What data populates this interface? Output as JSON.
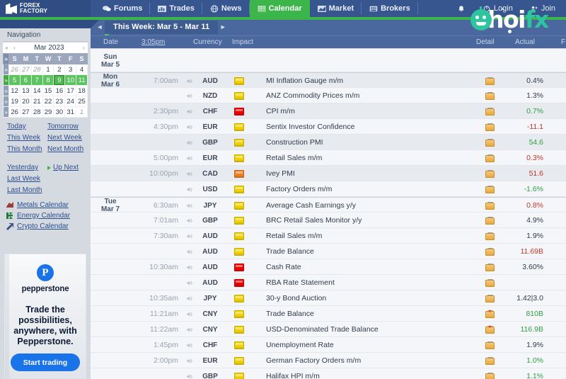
{
  "brand": {
    "line1": "FOREX",
    "line2": "FACTORY",
    "logo_icon": "forex-factory-logo-icon"
  },
  "topnav": {
    "items": [
      {
        "label": "Forums",
        "icon": "speech-bubbles-icon",
        "active": false
      },
      {
        "label": "Trades",
        "icon": "bar-chart-icon",
        "active": false
      },
      {
        "label": "News",
        "icon": "globe-icon",
        "active": false
      },
      {
        "label": "Calendar",
        "icon": "calendar-grid-icon",
        "active": true
      },
      {
        "label": "Market",
        "icon": "mountain-chart-icon",
        "active": false
      },
      {
        "label": "Brokers",
        "icon": "building-icon",
        "active": false
      }
    ],
    "right": [
      {
        "label": "",
        "icon": "bell-icon"
      },
      {
        "label": "Login",
        "icon": "login-icon"
      },
      {
        "label": "Join",
        "icon": "user-plus-icon"
      }
    ],
    "accent_color": "#3cb54a",
    "bar_color": "#37568f"
  },
  "watermark": {
    "text_dark": "ch",
    "text_mid": "o",
    "text_light": "i",
    "text_accent": "fx",
    "full": "choifx",
    "color": "#2ec4a0"
  },
  "sidebar": {
    "title": "Navigation",
    "datepicker": {
      "month_label": "Mar 2023",
      "prev_year_icon": "double-chevron-left-icon",
      "prev_month_icon": "chevron-left-icon",
      "next_month_icon": "chevron-right-icon",
      "weekday_headers": [
        "S",
        "M",
        "T",
        "W",
        "T",
        "F",
        "S"
      ],
      "week_col_icon": "week-select-icon",
      "weeks": [
        {
          "selected": false,
          "days": [
            {
              "n": "26",
              "out": true
            },
            {
              "n": "27",
              "out": true
            },
            {
              "n": "28",
              "out": true
            },
            {
              "n": "1"
            },
            {
              "n": "2"
            },
            {
              "n": "3"
            },
            {
              "n": "4"
            }
          ]
        },
        {
          "selected": true,
          "days": [
            {
              "n": "5"
            },
            {
              "n": "6"
            },
            {
              "n": "7"
            },
            {
              "n": "8"
            },
            {
              "n": "9",
              "today": true
            },
            {
              "n": "10"
            },
            {
              "n": "11"
            }
          ]
        },
        {
          "selected": false,
          "days": [
            {
              "n": "12"
            },
            {
              "n": "13"
            },
            {
              "n": "14"
            },
            {
              "n": "15"
            },
            {
              "n": "16"
            },
            {
              "n": "17"
            },
            {
              "n": "18"
            }
          ]
        },
        {
          "selected": false,
          "days": [
            {
              "n": "19"
            },
            {
              "n": "20"
            },
            {
              "n": "21"
            },
            {
              "n": "22"
            },
            {
              "n": "23"
            },
            {
              "n": "24"
            },
            {
              "n": "25"
            }
          ]
        },
        {
          "selected": false,
          "days": [
            {
              "n": "26"
            },
            {
              "n": "27"
            },
            {
              "n": "28"
            },
            {
              "n": "29"
            },
            {
              "n": "30"
            },
            {
              "n": "31"
            },
            {
              "n": "1",
              "out": true
            }
          ]
        }
      ]
    },
    "quicklinks": [
      "Today",
      "Tomorrow",
      "This Week",
      "Next Week",
      "This Month",
      "Next Month"
    ],
    "quicklinks2_left": [
      "Yesterday",
      "Last Week",
      "Last Month"
    ],
    "upnext_label": "Up Next",
    "other_calendars": [
      {
        "label": "Metals Calendar",
        "icon": "metals-icon",
        "color": "#a03a3a"
      },
      {
        "label": "Energy Calendar",
        "icon": "energy-icon",
        "color": "#1f7a3a"
      },
      {
        "label": "Crypto Calendar",
        "icon": "crypto-icon",
        "color": "#3a4f8a"
      }
    ]
  },
  "ad": {
    "logo_icon": "pepperstone-logo-icon",
    "logo_letter": "P",
    "brand": "pepperstone",
    "tagline": "Trade the possibilities, anywhere, with Pepperstone.",
    "cta": "Start trading"
  },
  "calendar": {
    "week_title": "This Week: Mar 5 - Mar 11",
    "prev_icon": "chevron-left-icon",
    "next_icon": "chevron-right-icon",
    "columns": {
      "date": "Date",
      "time": "3:05pm",
      "currency": "Currency",
      "impact": "Impact",
      "detail": "Detail",
      "actual": "Actual",
      "forecast": "F"
    },
    "rows": [
      {
        "date": [
          "Sun",
          "Mar 5"
        ],
        "empty": true,
        "shade": false,
        "daystart": true
      },
      {
        "date": [
          "Mon",
          "Mar 6"
        ],
        "time": "7:00am",
        "speaker": true,
        "currency": "AUD",
        "impact": "yellow",
        "event": "MI Inflation Gauge m/m",
        "detail": "folder",
        "actual": "0.4%",
        "actual_color": "neutral",
        "shade": true,
        "daystart": true
      },
      {
        "date": null,
        "time": "",
        "speaker": true,
        "currency": "NZD",
        "impact": "yellow",
        "event": "ANZ Commodity Prices m/m",
        "detail": "folder",
        "actual": "1.3%",
        "actual_color": "neutral",
        "shade": false
      },
      {
        "date": null,
        "time": "2:30pm",
        "speaker": true,
        "currency": "CHF",
        "impact": "red",
        "event": "CPI m/m",
        "detail": "folder",
        "actual": "0.7%",
        "actual_color": "up",
        "shade": true
      },
      {
        "date": null,
        "time": "4:30pm",
        "speaker": true,
        "currency": "EUR",
        "impact": "yellow",
        "event": "Sentix Investor Confidence",
        "detail": "folder",
        "actual": "-11.1",
        "actual_color": "down",
        "shade": false
      },
      {
        "date": null,
        "time": "",
        "speaker": true,
        "currency": "GBP",
        "impact": "yellow",
        "event": "Construction PMI",
        "detail": "folder",
        "actual": "54.6",
        "actual_color": "up",
        "shade": true
      },
      {
        "date": null,
        "time": "5:00pm",
        "speaker": true,
        "currency": "EUR",
        "impact": "yellow",
        "event": "Retail Sales m/m",
        "detail": "folder",
        "actual": "0.3%",
        "actual_color": "down",
        "shade": false
      },
      {
        "date": null,
        "time": "10:00pm",
        "speaker": true,
        "currency": "CAD",
        "impact": "orange",
        "event": "Ivey PMI",
        "detail": "folder",
        "actual": "51.6",
        "actual_color": "down",
        "shade": true
      },
      {
        "date": null,
        "time": "",
        "speaker": true,
        "currency": "USD",
        "impact": "yellow",
        "event": "Factory Orders m/m",
        "detail": "folder",
        "actual": "-1.6%",
        "actual_color": "up",
        "shade": false
      },
      {
        "date": [
          "Tue",
          "Mar 7"
        ],
        "time": "6:30am",
        "speaker": true,
        "currency": "JPY",
        "impact": "yellow",
        "event": "Average Cash Earnings y/y",
        "detail": "folder",
        "actual": "0.8%",
        "actual_color": "down",
        "shade": false,
        "daystart": true
      },
      {
        "date": null,
        "time": "7:01am",
        "speaker": true,
        "currency": "GBP",
        "impact": "yellow",
        "event": "BRC Retail Sales Monitor y/y",
        "detail": "folder",
        "actual": "4.9%",
        "actual_color": "neutral",
        "shade": false
      },
      {
        "date": null,
        "time": "7:30am",
        "speaker": true,
        "currency": "AUD",
        "impact": "yellow",
        "event": "Retail Sales m/m",
        "detail": "folder",
        "actual": "1.9%",
        "actual_color": "neutral",
        "shade": false
      },
      {
        "date": null,
        "time": "",
        "speaker": true,
        "currency": "AUD",
        "impact": "yellow",
        "event": "Trade Balance",
        "detail": "folder",
        "actual": "11.69B",
        "actual_color": "down",
        "shade": false
      },
      {
        "date": null,
        "time": "10:30am",
        "speaker": true,
        "currency": "AUD",
        "impact": "red",
        "event": "Cash Rate",
        "detail": "folder",
        "actual": "3.60%",
        "actual_color": "neutral",
        "shade": false
      },
      {
        "date": null,
        "time": "",
        "speaker": true,
        "currency": "AUD",
        "impact": "red",
        "event": "RBA Rate Statement",
        "detail": "folder",
        "actual": "",
        "actual_color": "neutral",
        "shade": false
      },
      {
        "date": null,
        "time": "10:35am",
        "speaker": true,
        "currency": "JPY",
        "impact": "yellow",
        "event": "30-y Bond Auction",
        "detail": "folder",
        "actual": "1.42|3.0",
        "actual_color": "neutral",
        "shade": false
      },
      {
        "date": null,
        "time": "11:21am",
        "speaker": true,
        "currency": "CNY",
        "impact": "yellow",
        "event": "Trade Balance",
        "detail": "folder-star",
        "actual": "810B",
        "actual_color": "up",
        "shade": false
      },
      {
        "date": null,
        "time": "11:22am",
        "speaker": true,
        "currency": "CNY",
        "impact": "yellow",
        "event": "USD-Denominated Trade Balance",
        "detail": "folder-star",
        "actual": "116.9B",
        "actual_color": "up",
        "shade": false
      },
      {
        "date": null,
        "time": "1:45pm",
        "speaker": true,
        "currency": "CHF",
        "impact": "yellow",
        "event": "Unemployment Rate",
        "detail": "folder",
        "actual": "1.9%",
        "actual_color": "neutral",
        "shade": false
      },
      {
        "date": null,
        "time": "2:00pm",
        "speaker": true,
        "currency": "EUR",
        "impact": "yellow",
        "event": "German Factory Orders m/m",
        "detail": "folder",
        "actual": "1.0%",
        "actual_color": "up",
        "shade": false
      },
      {
        "date": null,
        "time": "",
        "speaker": true,
        "currency": "GBP",
        "impact": "yellow",
        "event": "Halifax HPI m/m",
        "detail": "folder",
        "actual": "1.1%",
        "actual_color": "up",
        "shade": false
      }
    ]
  },
  "colors": {
    "impact_yellow": "#f2d100",
    "impact_orange": "#ef8021",
    "impact_red": "#ef0000",
    "value_up": "#2f9e41",
    "value_down": "#c0392b",
    "value_neutral": "#333b49"
  }
}
